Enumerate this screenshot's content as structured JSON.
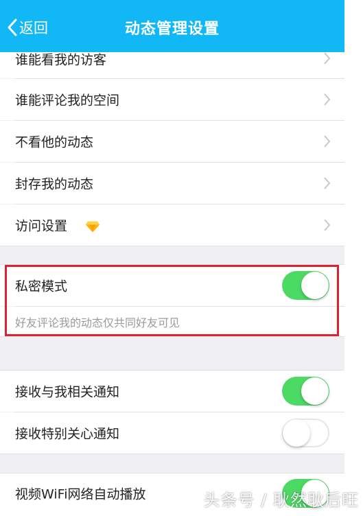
{
  "navbar": {
    "back_label": "返回",
    "title": "动态管理设置",
    "color": "#12b7f5"
  },
  "group1": {
    "items": [
      {
        "label": "谁能看我的访客"
      },
      {
        "label": "谁能评论我的空间"
      },
      {
        "label": "不看他的动态"
      },
      {
        "label": "封存我的动态"
      },
      {
        "label": "访问设置",
        "badge_icon": "diamond-icon"
      }
    ]
  },
  "privacy": {
    "label": "私密模式",
    "enabled": true,
    "description": "好友评论我的动态仅共同好友可见"
  },
  "notifications": {
    "items": [
      {
        "label": "接收与我相关通知",
        "enabled": true
      },
      {
        "label": "接收特别关心通知",
        "enabled": false
      }
    ]
  },
  "video": {
    "label": "视频WiFi网络自动播放",
    "enabled": true
  },
  "watermark": "头条号 / 耿然耿后旺",
  "colors": {
    "toggle_on": "#4cd964",
    "highlight_border": "#d9232e"
  }
}
